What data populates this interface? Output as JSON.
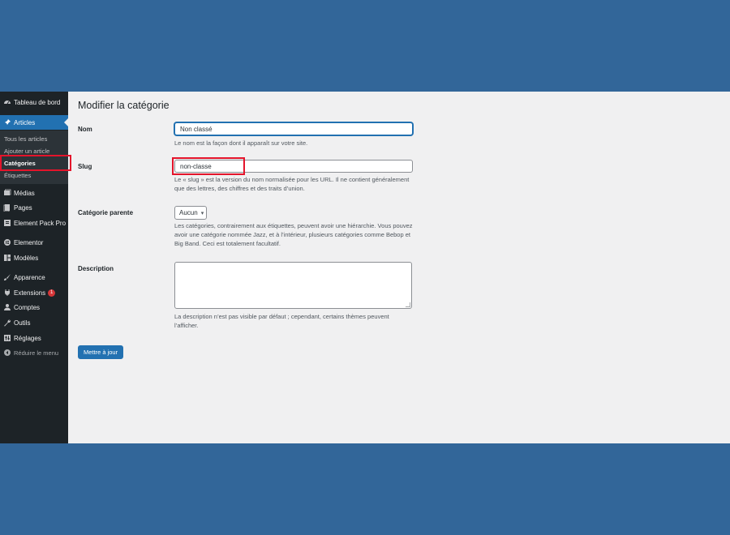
{
  "sidebar": {
    "items": [
      {
        "label": "Tableau de bord",
        "icon": "dashboard-icon"
      },
      {
        "label": "Articles",
        "icon": "pin-icon"
      },
      {
        "label": "Médias",
        "icon": "media-icon"
      },
      {
        "label": "Pages",
        "icon": "pages-icon"
      },
      {
        "label": "Element Pack Pro",
        "icon": "element-pack-icon"
      },
      {
        "label": "Elementor",
        "icon": "elementor-icon"
      },
      {
        "label": "Modèles",
        "icon": "templates-icon"
      },
      {
        "label": "Apparence",
        "icon": "brush-icon"
      },
      {
        "label": "Extensions",
        "icon": "plugin-icon",
        "badge": "1"
      },
      {
        "label": "Comptes",
        "icon": "user-icon"
      },
      {
        "label": "Outils",
        "icon": "wrench-icon"
      },
      {
        "label": "Réglages",
        "icon": "settings-icon"
      }
    ],
    "submenu": [
      "Tous les articles",
      "Ajouter un article",
      "Catégories",
      "Étiquettes"
    ],
    "collapse_label": "Réduire le menu"
  },
  "page": {
    "title": "Modifier la catégorie",
    "name": {
      "label": "Nom",
      "value": "Non classé",
      "help": "Le nom est la façon dont il apparaît sur votre site."
    },
    "slug": {
      "label": "Slug",
      "value": "non-classe",
      "help": "Le « slug » est la version du nom normalisée pour les URL. Il ne contient généralement que des lettres, des chiffres et des traits d’union."
    },
    "parent": {
      "label": "Catégorie parente",
      "value": "Aucun",
      "help": "Les catégories, contrairement aux étiquettes, peuvent avoir une hiérarchie. Vous pouvez avoir une catégorie nommée Jazz, et à l’intérieur, plusieurs catégories comme Bebop et Big Band. Ceci est totalement facultatif."
    },
    "description": {
      "label": "Description",
      "value": "",
      "help": "La description n’est pas visible par défaut ; cependant, certains thèmes peuvent l’afficher."
    },
    "update_label": "Mettre à jour"
  },
  "colors": {
    "accent": "#2271b1",
    "sidebar": "#1d2327",
    "highlight": "#e4142b",
    "background": "#326699"
  }
}
